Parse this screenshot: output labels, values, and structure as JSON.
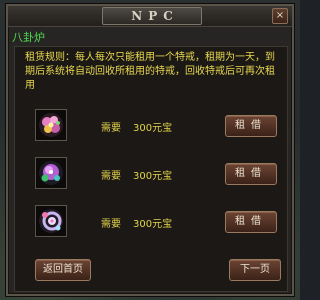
{
  "window": {
    "title": "NPC",
    "close_label": "×"
  },
  "subtitle": "八卦炉",
  "rules_text": "租赁规则：每人每次只能租用一个特戒，租期为一天，到期后系统将自动回收所租用的特戒，回收特戒后可再次租用",
  "items": [
    {
      "icon": "pink-flower-ring-icon",
      "price_label": "需要",
      "price_value": "300元宝",
      "rent_label": "租借"
    },
    {
      "icon": "purple-green-ring-icon",
      "price_label": "需要",
      "price_value": "300元宝",
      "rent_label": "租借"
    },
    {
      "icon": "lavender-spiral-ring-icon",
      "price_label": "需要",
      "price_value": "300元宝",
      "rent_label": "租借"
    }
  ],
  "footer": {
    "back_label": "返回首页",
    "next_label": "下一页"
  },
  "colors": {
    "subtitle": "#4fd84f",
    "rules": "#e9d94f",
    "button": "#6b4433"
  }
}
